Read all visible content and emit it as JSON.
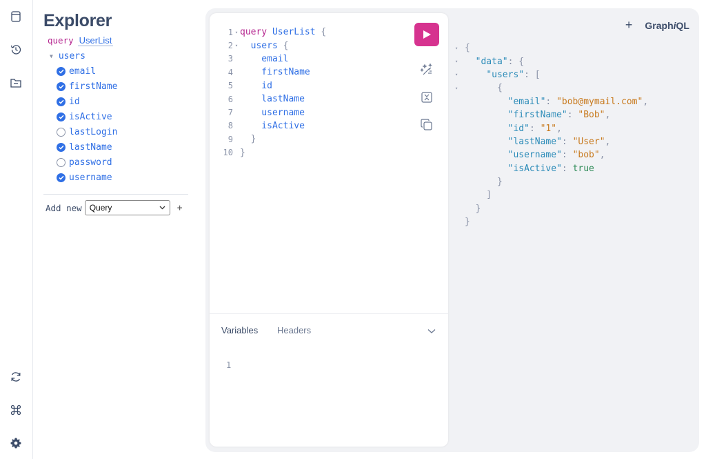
{
  "explorer": {
    "title": "Explorer",
    "operation_keyword": "query",
    "operation_name": "UserList",
    "root_field": "users",
    "fields": [
      {
        "name": "email",
        "checked": true
      },
      {
        "name": "firstName",
        "checked": true
      },
      {
        "name": "id",
        "checked": true
      },
      {
        "name": "isActive",
        "checked": true
      },
      {
        "name": "lastLogin",
        "checked": false
      },
      {
        "name": "lastName",
        "checked": true
      },
      {
        "name": "password",
        "checked": false
      },
      {
        "name": "username",
        "checked": true
      }
    ],
    "add_new_label": "Add new",
    "add_new_select": "Query",
    "add_plus": "+"
  },
  "editor": {
    "lines": [
      {
        "n": "1",
        "fold": "▾",
        "segs": [
          {
            "t": "query",
            "c": "k"
          },
          {
            "t": " UserList ",
            "c": ""
          },
          {
            "t": "{",
            "c": "p"
          }
        ]
      },
      {
        "n": "2",
        "fold": "▾",
        "segs": [
          {
            "t": "  users ",
            "c": ""
          },
          {
            "t": "{",
            "c": "p"
          }
        ]
      },
      {
        "n": "3",
        "fold": "",
        "segs": [
          {
            "t": "    email",
            "c": ""
          }
        ]
      },
      {
        "n": "4",
        "fold": "",
        "segs": [
          {
            "t": "    firstName",
            "c": ""
          }
        ]
      },
      {
        "n": "5",
        "fold": "",
        "segs": [
          {
            "t": "    id",
            "c": ""
          }
        ]
      },
      {
        "n": "6",
        "fold": "",
        "segs": [
          {
            "t": "    lastName",
            "c": ""
          }
        ]
      },
      {
        "n": "7",
        "fold": "",
        "segs": [
          {
            "t": "    username",
            "c": ""
          }
        ]
      },
      {
        "n": "8",
        "fold": "",
        "segs": [
          {
            "t": "    isActive",
            "c": ""
          }
        ]
      },
      {
        "n": "9",
        "fold": "",
        "segs": [
          {
            "t": "  }",
            "c": "p"
          }
        ]
      },
      {
        "n": "10",
        "fold": "",
        "segs": [
          {
            "t": "}",
            "c": "p"
          }
        ]
      }
    ]
  },
  "variables": {
    "tab_variables": "Variables",
    "tab_headers": "Headers",
    "line_number": "1"
  },
  "header": {
    "plus": "+",
    "brand_prefix": "Graph",
    "brand_italic": "i",
    "brand_suffix": "QL"
  },
  "result": {
    "lines": [
      {
        "fold": "▾",
        "segs": [
          {
            "t": "{",
            "c": "p"
          }
        ]
      },
      {
        "fold": "▾",
        "segs": [
          {
            "t": "  ",
            "c": ""
          },
          {
            "t": "\"data\"",
            "c": "k"
          },
          {
            "t": ": {",
            "c": "p"
          }
        ]
      },
      {
        "fold": "▾",
        "segs": [
          {
            "t": "    ",
            "c": ""
          },
          {
            "t": "\"users\"",
            "c": "k"
          },
          {
            "t": ": [",
            "c": "p"
          }
        ]
      },
      {
        "fold": "▾",
        "segs": [
          {
            "t": "      {",
            "c": "p"
          }
        ]
      },
      {
        "fold": "",
        "segs": [
          {
            "t": "        ",
            "c": ""
          },
          {
            "t": "\"email\"",
            "c": "k"
          },
          {
            "t": ": ",
            "c": "p"
          },
          {
            "t": "\"bob@mymail.com\"",
            "c": "s"
          },
          {
            "t": ",",
            "c": "p"
          }
        ]
      },
      {
        "fold": "",
        "segs": [
          {
            "t": "        ",
            "c": ""
          },
          {
            "t": "\"firstName\"",
            "c": "k"
          },
          {
            "t": ": ",
            "c": "p"
          },
          {
            "t": "\"Bob\"",
            "c": "s"
          },
          {
            "t": ",",
            "c": "p"
          }
        ]
      },
      {
        "fold": "",
        "segs": [
          {
            "t": "        ",
            "c": ""
          },
          {
            "t": "\"id\"",
            "c": "k"
          },
          {
            "t": ": ",
            "c": "p"
          },
          {
            "t": "\"1\"",
            "c": "s"
          },
          {
            "t": ",",
            "c": "p"
          }
        ]
      },
      {
        "fold": "",
        "segs": [
          {
            "t": "        ",
            "c": ""
          },
          {
            "t": "\"lastName\"",
            "c": "k"
          },
          {
            "t": ": ",
            "c": "p"
          },
          {
            "t": "\"User\"",
            "c": "s"
          },
          {
            "t": ",",
            "c": "p"
          }
        ]
      },
      {
        "fold": "",
        "segs": [
          {
            "t": "        ",
            "c": ""
          },
          {
            "t": "\"username\"",
            "c": "k"
          },
          {
            "t": ": ",
            "c": "p"
          },
          {
            "t": "\"bob\"",
            "c": "s"
          },
          {
            "t": ",",
            "c": "p"
          }
        ]
      },
      {
        "fold": "",
        "segs": [
          {
            "t": "        ",
            "c": ""
          },
          {
            "t": "\"isActive\"",
            "c": "k"
          },
          {
            "t": ": ",
            "c": "p"
          },
          {
            "t": "true",
            "c": "b"
          }
        ]
      },
      {
        "fold": "",
        "segs": [
          {
            "t": "      }",
            "c": "p"
          }
        ]
      },
      {
        "fold": "",
        "segs": [
          {
            "t": "    ]",
            "c": "p"
          }
        ]
      },
      {
        "fold": "",
        "segs": [
          {
            "t": "  }",
            "c": "p"
          }
        ]
      },
      {
        "fold": "",
        "segs": [
          {
            "t": "}",
            "c": "p"
          }
        ]
      }
    ]
  },
  "colors": {
    "accent": "#d6338f",
    "keyword": "#b5258f",
    "field": "#2f6fe5",
    "json_key": "#2b8bb8",
    "json_string": "#c87a1e",
    "json_bool": "#2e8b57"
  },
  "icons": {
    "sidebar_top": [
      "docs-icon",
      "history-icon",
      "explorer-folder-icon"
    ],
    "sidebar_bottom": [
      "refetch-schema-icon",
      "shortcuts-command-icon",
      "settings-gear-icon"
    ],
    "editor_tools": [
      "run-icon",
      "prettify-icon",
      "merge-fragments-icon",
      "copy-icon"
    ]
  }
}
